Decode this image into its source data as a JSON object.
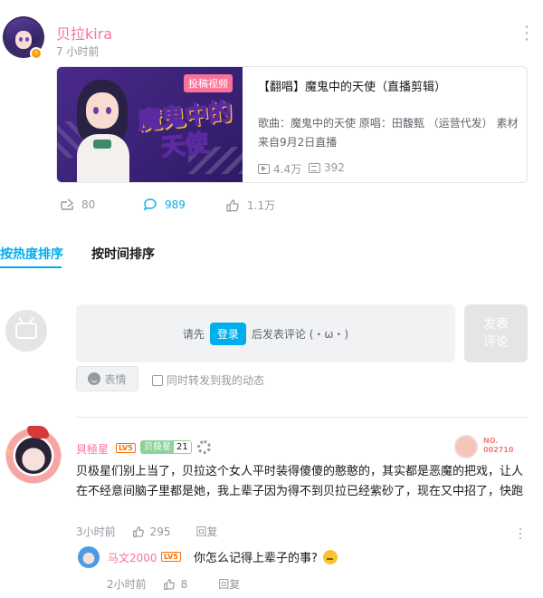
{
  "post": {
    "username": "贝拉kira",
    "time": "7 小时前",
    "video": {
      "tag": "投稿视频",
      "thumb_title_line1": "魔鬼中的",
      "thumb_title_line2": "天使",
      "title": "【翻唱】魔鬼中的天使（直播剪辑）",
      "description": "歌曲：魔鬼中的天使 原唱：田馥甄 （运营代发） 素材来自9月2日直播 ————————————————————…",
      "views": "4.4万",
      "danmaku": "392"
    },
    "actions": {
      "share": "80",
      "comment": "989",
      "like": "1.1万"
    }
  },
  "sort": {
    "hot": "按热度排序",
    "time": "按时间排序"
  },
  "composer": {
    "prefix": "请先",
    "login": "登录",
    "suffix": "后发表评论 (・ω・)",
    "submit": "发表\n评论",
    "emoji": "表情",
    "repost": "同时转发到我的动态"
  },
  "comments": [
    {
      "name": "貝極星",
      "level": "LV5",
      "fan_badge_name": "贝极星",
      "fan_badge_level": "21",
      "no_badge": "NO.\n002710",
      "text": "贝极星们别上当了，贝拉这个女人平时装得傻傻的憨憨的，其实都是恶魔的把戏，让人在不经意间脑子里都是她，我上辈子因为得不到贝拉已经紫砂了，现在又中招了，快跑",
      "time": "3小时前",
      "likes": "295",
      "reply_label": "回复",
      "reply": {
        "name": "马文2000",
        "level": "LV5",
        "text": "你怎么记得上辈子的事?",
        "time": "2小时前",
        "likes": "8",
        "reply_label": "回复"
      }
    }
  ],
  "colors": {
    "accent": "#00aeec",
    "pink": "#fb7299",
    "muted": "#9499a0"
  },
  "icons": [
    "more-icon",
    "play-icon",
    "danmaku-icon",
    "share-icon",
    "comment-icon",
    "like-icon",
    "smile-icon",
    "tv-icon",
    "gear-icon"
  ]
}
